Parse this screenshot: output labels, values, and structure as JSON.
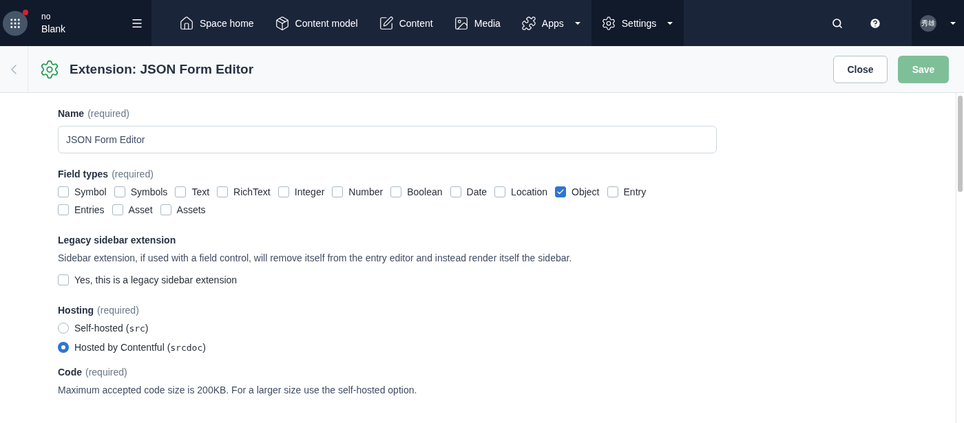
{
  "space": {
    "org": "no",
    "name": "Blank",
    "notification": true
  },
  "nav": [
    {
      "label": "Space home",
      "dropdown": false,
      "selected": false
    },
    {
      "label": "Content model",
      "dropdown": false,
      "selected": false
    },
    {
      "label": "Content",
      "dropdown": false,
      "selected": false
    },
    {
      "label": "Media",
      "dropdown": false,
      "selected": false
    },
    {
      "label": "Apps",
      "dropdown": true,
      "selected": false
    },
    {
      "label": "Settings",
      "dropdown": true,
      "selected": true
    }
  ],
  "user": {
    "avatar": "秀雄"
  },
  "header": {
    "title": "Extension: JSON Form Editor",
    "close": "Close",
    "save": "Save",
    "save_disabled": true
  },
  "form": {
    "name": {
      "label": "Name",
      "hint": "(required)",
      "value": "JSON Form Editor"
    },
    "field_types": {
      "label": "Field types",
      "hint": "(required)",
      "options": [
        {
          "label": "Symbol",
          "checked": false
        },
        {
          "label": "Symbols",
          "checked": false
        },
        {
          "label": "Text",
          "checked": false
        },
        {
          "label": "RichText",
          "checked": false
        },
        {
          "label": "Integer",
          "checked": false
        },
        {
          "label": "Number",
          "checked": false
        },
        {
          "label": "Boolean",
          "checked": false
        },
        {
          "label": "Date",
          "checked": false
        },
        {
          "label": "Location",
          "checked": false
        },
        {
          "label": "Object",
          "checked": true
        },
        {
          "label": "Entry",
          "checked": false
        },
        {
          "label": "Entries",
          "checked": false
        },
        {
          "label": "Asset",
          "checked": false
        },
        {
          "label": "Assets",
          "checked": false
        }
      ]
    },
    "legacy": {
      "label": "Legacy sidebar extension",
      "description": "Sidebar extension, if used with a field control, will remove itself from the entry editor and instead render itself the sidebar.",
      "option": {
        "label": "Yes, this is a legacy sidebar extension",
        "checked": false
      }
    },
    "hosting": {
      "label": "Hosting",
      "hint": "(required)",
      "options": [
        {
          "label": "Self-hosted (",
          "code": "src",
          "after": ")",
          "selected": false
        },
        {
          "label": "Hosted by Contentful (",
          "code": "srcdoc",
          "after": ")",
          "selected": true
        }
      ]
    },
    "code": {
      "label": "Code",
      "hint": "(required)",
      "description": "Maximum accepted code size is 200KB. For a larger size use the self-hosted option."
    }
  }
}
